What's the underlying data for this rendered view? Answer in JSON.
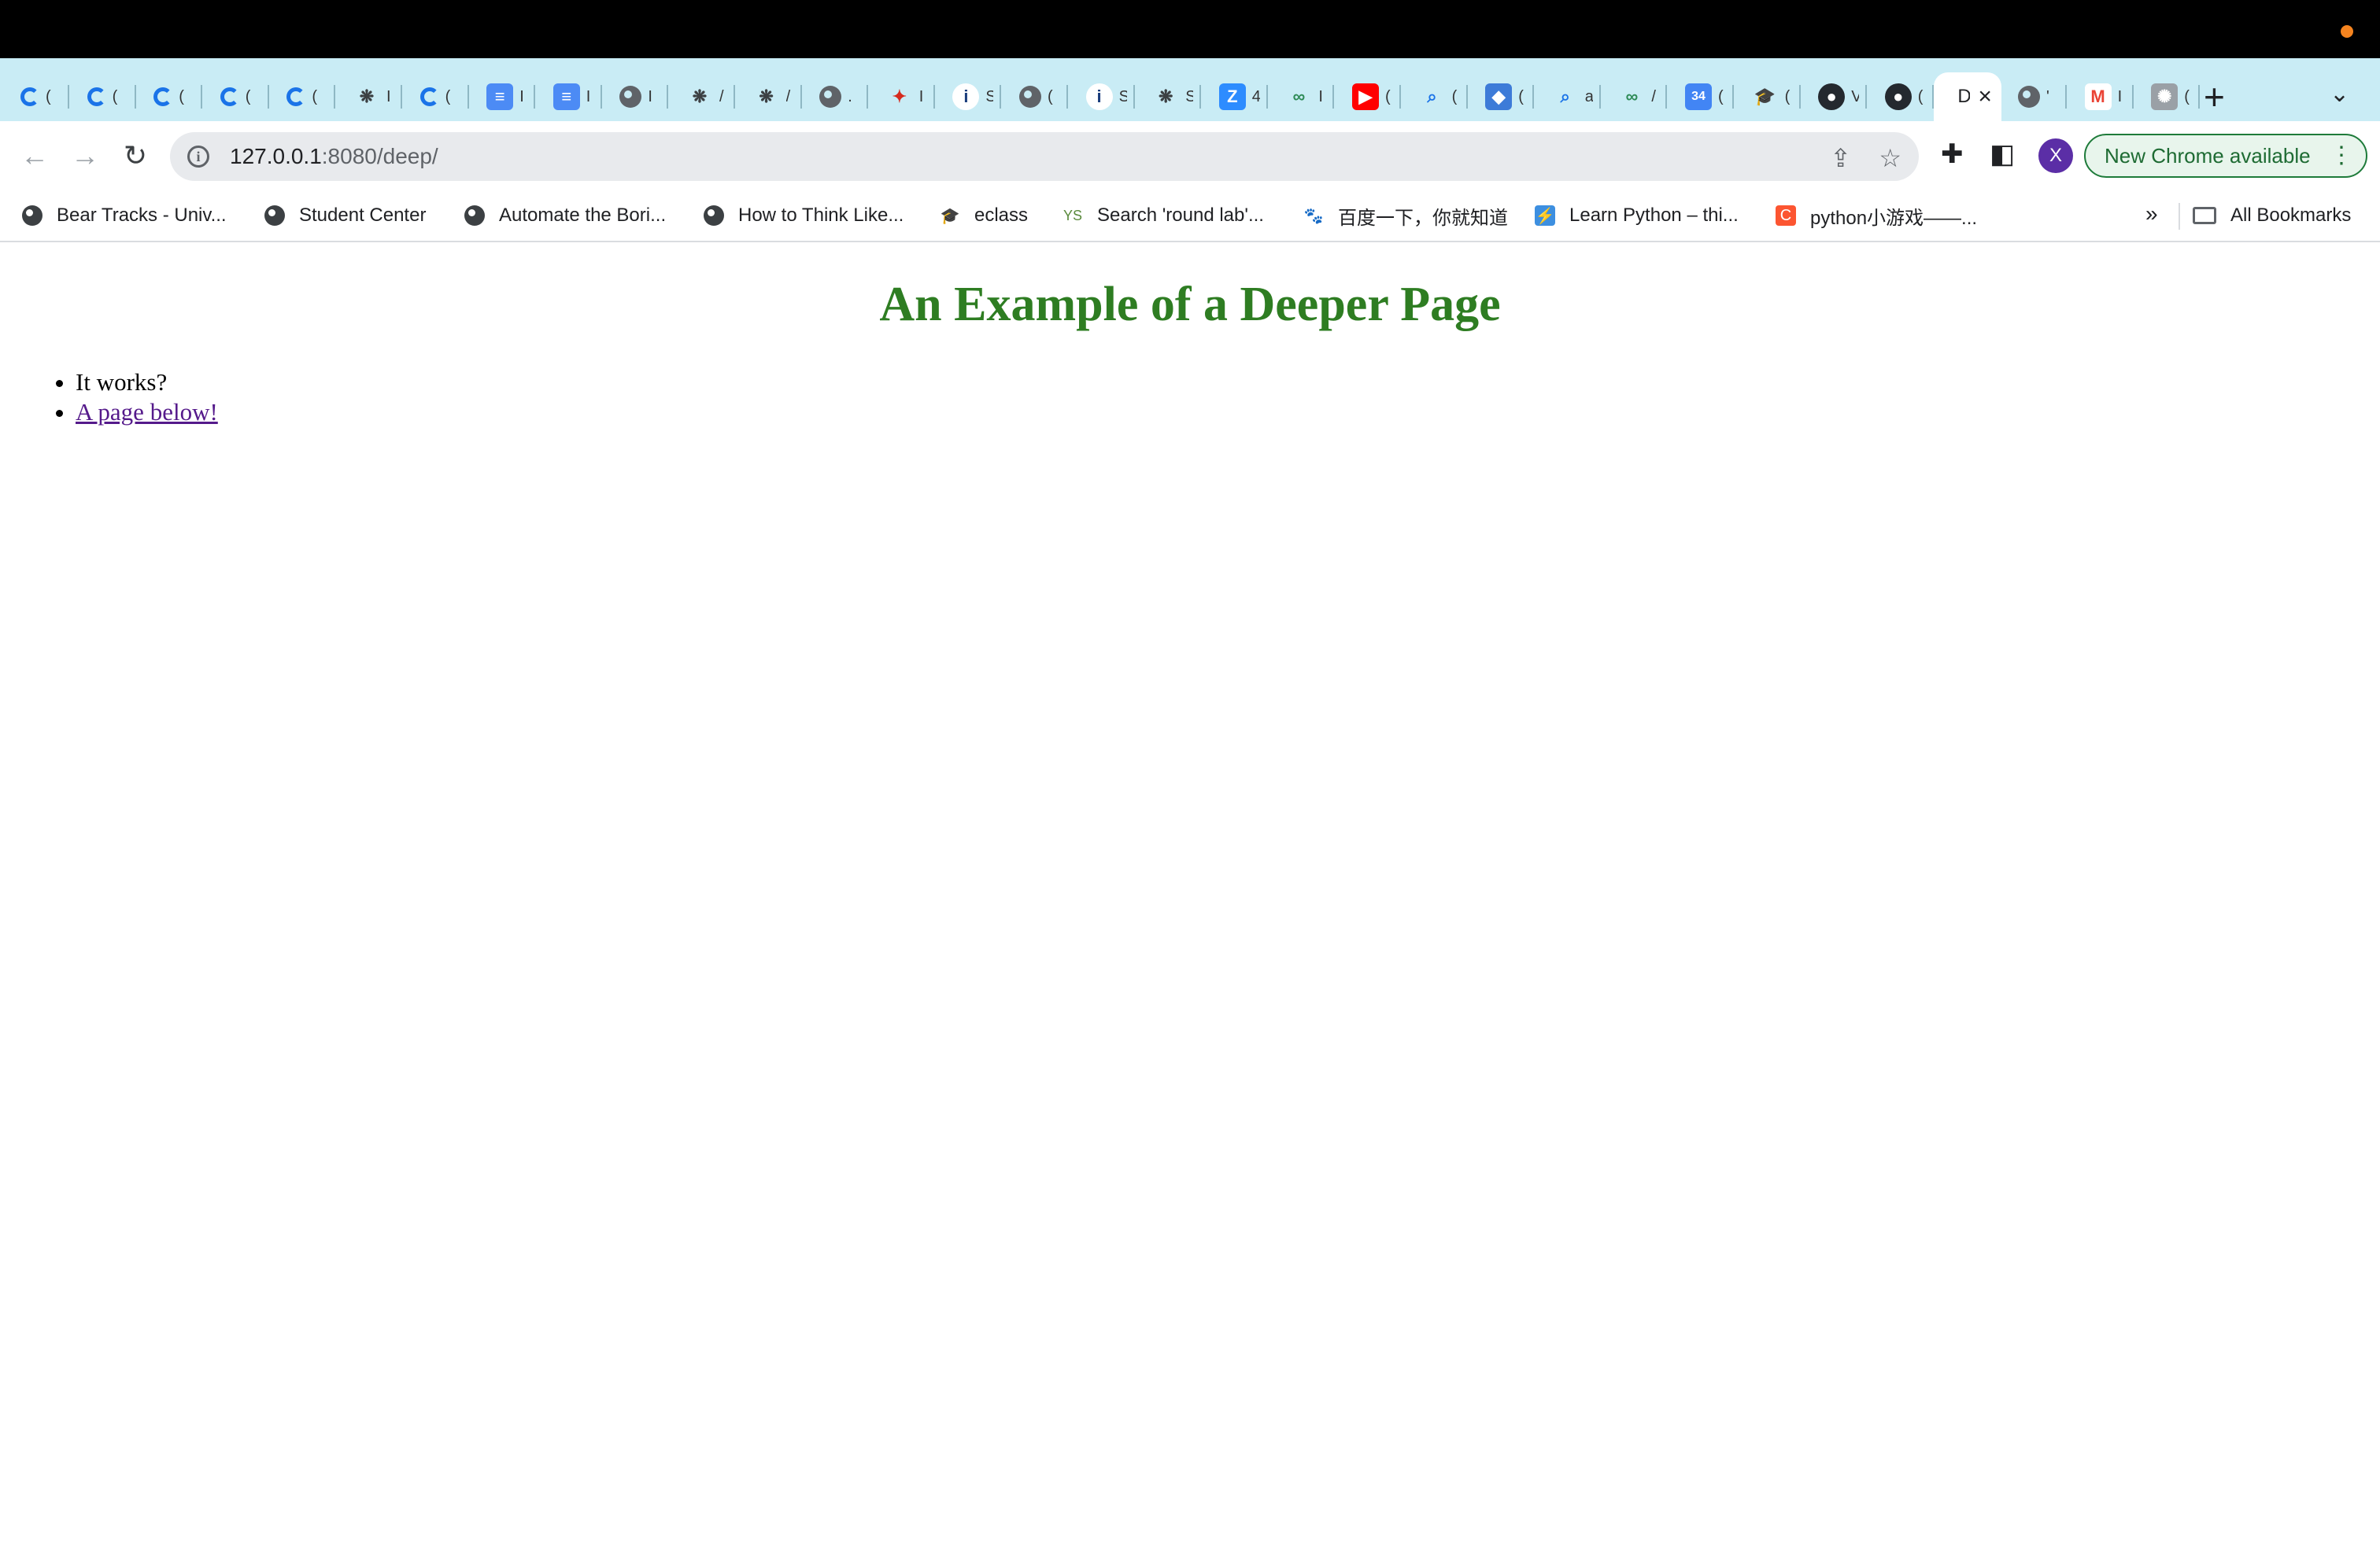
{
  "window": {
    "status_dot_color": "#f5841f"
  },
  "tabs": {
    "items": [
      {
        "icon": "loading-spinner-icon",
        "title": "("
      },
      {
        "icon": "loading-spinner-icon",
        "title": "("
      },
      {
        "icon": "loading-spinner-icon",
        "title": "("
      },
      {
        "icon": "loading-spinner-icon",
        "title": "("
      },
      {
        "icon": "loading-spinner-icon",
        "title": "("
      },
      {
        "icon": "bee-icon",
        "title": "I"
      },
      {
        "icon": "loading-spinner-icon",
        "title": "("
      },
      {
        "icon": "docs-icon",
        "title": "I"
      },
      {
        "icon": "docs-icon",
        "title": "I"
      },
      {
        "icon": "globe-icon",
        "title": "I"
      },
      {
        "icon": "bee-icon",
        "title": "/"
      },
      {
        "icon": "bee-icon",
        "title": "/"
      },
      {
        "icon": "globe-icon",
        "title": "."
      },
      {
        "icon": "maple-leaf-icon",
        "title": "I"
      },
      {
        "icon": "info-icon",
        "title": "S"
      },
      {
        "icon": "globe-icon",
        "title": "("
      },
      {
        "icon": "info-icon",
        "title": "S"
      },
      {
        "icon": "bee-icon",
        "title": "S"
      },
      {
        "icon": "zoom-icon",
        "title": "4"
      },
      {
        "icon": "leetcode-icon",
        "title": "I"
      },
      {
        "icon": "youtube-icon",
        "title": "("
      },
      {
        "icon": "search-icon",
        "title": "("
      },
      {
        "icon": "diamond-icon",
        "title": "("
      },
      {
        "icon": "search-icon",
        "title": "a"
      },
      {
        "icon": "leetcode-icon",
        "title": "/"
      },
      {
        "icon": "calendar-icon",
        "title": "("
      },
      {
        "icon": "eclass-icon",
        "title": "("
      },
      {
        "icon": "github-icon",
        "title": "V"
      },
      {
        "icon": "github-icon",
        "title": "("
      },
      {
        "icon": "none",
        "title": "D",
        "active": true
      },
      {
        "icon": "globe-icon",
        "title": "'"
      },
      {
        "icon": "gmail-icon",
        "title": "I"
      },
      {
        "icon": "openai-icon",
        "title": "("
      }
    ],
    "new_tab": "+",
    "tab_search": "⌄"
  },
  "toolbar": {
    "back": "←",
    "forward": "→",
    "reload": "↻",
    "url_host": "127.0.0.1",
    "url_path": ":8080/deep/",
    "avatar_letter": "X",
    "avatar_color": "#5b2ea6",
    "update_label": "New Chrome available",
    "update_menu": "⋮"
  },
  "bookmarks": {
    "items": [
      {
        "icon": "globe-icon",
        "label": "Bear Tracks - Univ..."
      },
      {
        "icon": "globe-icon",
        "label": "Student Center"
      },
      {
        "icon": "globe-icon",
        "label": "Automate the Bori..."
      },
      {
        "icon": "globe-icon",
        "label": "How to Think Like..."
      },
      {
        "icon": "eclass-icon",
        "label": "eclass"
      },
      {
        "icon": "ys-icon",
        "label": "Search 'round lab'..."
      },
      {
        "icon": "baidu-icon",
        "label": "百度一下，你就知道"
      },
      {
        "icon": "learnpython-icon",
        "label": "Learn Python – thi..."
      },
      {
        "icon": "csdn-icon",
        "label": "python小游戏——..."
      }
    ],
    "more": "»",
    "all_bookmarks": "All Bookmarks"
  },
  "page": {
    "heading": "An Example of a Deeper Page",
    "heading_color": "#2e7d22",
    "list": [
      {
        "text": "It works?",
        "link": false
      },
      {
        "text": "A page below!",
        "link": true
      }
    ]
  }
}
